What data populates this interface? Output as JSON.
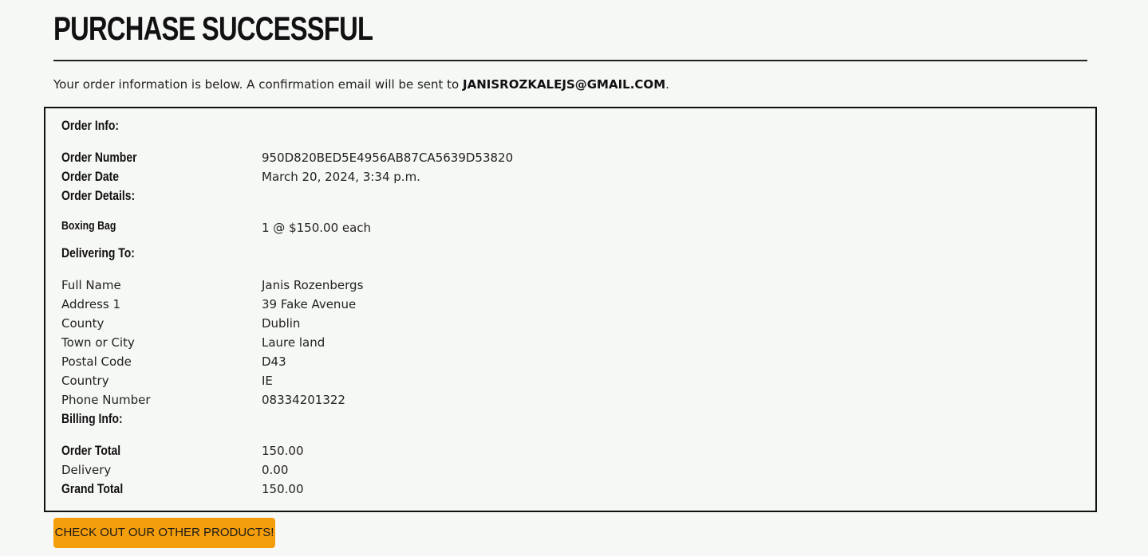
{
  "page": {
    "title": "PURCHASE SUCCESSFUL",
    "intro_text": "Your order information is below. A confirmation email will be sent to ",
    "email": "JANISROZKALEJS@GMAIL.COM",
    "intro_end": "."
  },
  "order_info": {
    "heading": "Order Info:",
    "order_number_label": "Order Number",
    "order_number": "950D820BED5E4956AB87CA5639D53820",
    "order_date_label": "Order Date",
    "order_date": "March 20, 2024, 3:34 p.m.",
    "order_details_label": "Order Details:",
    "items": [
      {
        "name": "Boxing Bag",
        "quantity_price": "1 @ $150.00 each"
      }
    ]
  },
  "delivery": {
    "heading": "Delivering To:",
    "rows": [
      {
        "label": "Full Name",
        "value": "Janis Rozenbergs"
      },
      {
        "label": "Address 1",
        "value": "39 Fake Avenue"
      },
      {
        "label": "County",
        "value": "Dublin"
      },
      {
        "label": "Town or City",
        "value": "Laure land"
      },
      {
        "label": "Postal Code",
        "value": "D43"
      },
      {
        "label": "Country",
        "value": "IE"
      },
      {
        "label": "Phone Number",
        "value": "08334201322"
      }
    ]
  },
  "billing": {
    "heading": "Billing Info:",
    "order_total_label": "Order Total",
    "order_total": "150.00",
    "delivery_label": "Delivery",
    "delivery": "0.00",
    "grand_total_label": "Grand Total",
    "grand_total": "150.00"
  },
  "actions": {
    "continue_label": "CHECK OUT OUR OTHER PRODUCTS!"
  },
  "colors": {
    "background": "#f6f8f5",
    "button": "#f59e0b",
    "text": "#1a1a1a"
  }
}
